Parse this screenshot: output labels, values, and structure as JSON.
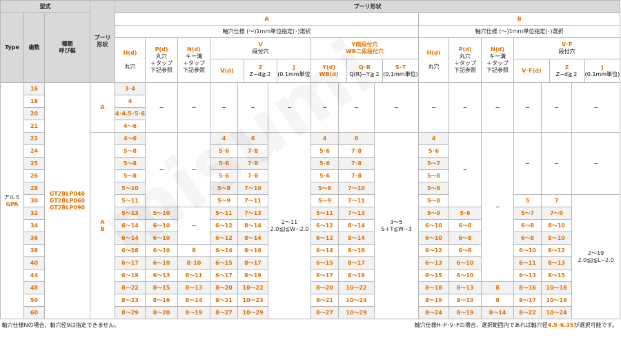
{
  "headers": {
    "katashiki": "型式",
    "type": "Type",
    "hasu": "歯数",
    "shurui_1": "種類",
    "shurui_2": "呼び幅",
    "pulley_shape_1": "プーリ",
    "pulley_shape_2": "形状",
    "pulley_shape_title": "プーリ形状",
    "group_a": "A",
    "group_b": "B",
    "spec_text": "軸穴仕様 (～)1mm単位指定(･)選択"
  },
  "subheaders": {
    "h_label": "H(d)",
    "h_sub": "丸穴",
    "p_label": "P(d)",
    "p_sub1": "丸穴",
    "p_sub2": "＋タップ",
    "p_sub3": "下記参照",
    "n_label": "N(d)",
    "n_sub1": "キー溝",
    "n_sub2": "＋タップ",
    "n_sub3": "下記参照",
    "v_top": "V",
    "v_sub": "段付穴",
    "y_top": "Y両段付穴",
    "wb_top": "WB二段段付穴",
    "v_label": "V(d)",
    "z_label": "Z",
    "z_sub": "Z−d≧２",
    "j_label": "J",
    "j_sub": "(0.1mm単位)",
    "y_label": "Y(d)",
    "wb_label": "WB(d)",
    "qr_label": "Q･R",
    "qr_sub": "Q(R)−Y≧２",
    "st_label": "S･T",
    "st_sub": "(0.1mm単位)",
    "vf_top": "V･F",
    "vf_sub": "段付穴",
    "vf_label": "V･F(d)",
    "z2_sub": "Z−d≧２",
    "j2_sub": "(0.1mm単位)"
  },
  "body": {
    "type_name": "アルミ",
    "type_code": "GPA",
    "models": [
      "GT2BLP040",
      "GT2BLP060",
      "GT2BLP090"
    ],
    "shape_a": "A",
    "shape_ab": "A",
    "shape_ab2": "B",
    "dash": "−",
    "j_a_range": "2～11",
    "j_a_cond": "2.0≦J≦W−2.0",
    "st_range": "3～5",
    "st_cond": "S＋T≦W−3",
    "j_b_range": "2～19",
    "j_b_cond": "2.0≦J≦L−2.0"
  },
  "rows": [
    {
      "teeth": "16",
      "h": "3･4",
      "v": "−",
      "z": "−",
      "y": "−",
      "qr": "−",
      "hb": "−",
      "vf": "−",
      "z2": "−"
    },
    {
      "teeth": "18",
      "h": "4",
      "v": "",
      "z": "",
      "y": "",
      "qr": "",
      "hb": "",
      "vf": "",
      "z2": ""
    },
    {
      "teeth": "20",
      "h": "4･4.5･5･6",
      "v": "",
      "z": "",
      "y": "",
      "qr": "",
      "hb": "",
      "vf": "",
      "z2": ""
    },
    {
      "teeth": "21",
      "h": "4～6",
      "v": "",
      "z": "",
      "y": "",
      "qr": "",
      "hb": "",
      "vf": "",
      "z2": ""
    },
    {
      "teeth": "22",
      "h": "4～6",
      "v": "4",
      "z": "6",
      "y": "4",
      "qr": "6",
      "hb": "4",
      "vf": "",
      "z2": ""
    },
    {
      "teeth": "24",
      "h": "5～8",
      "v": "5･6",
      "z": "7･8",
      "y": "5･6",
      "qr": "7･8",
      "hb": "5･6",
      "vf": "",
      "z2": ""
    },
    {
      "teeth": "25",
      "h": "5～8",
      "v": "5･6",
      "z": "7･8",
      "y": "5･6",
      "qr": "7･8",
      "hb": "5～7",
      "vf": "",
      "z2": ""
    },
    {
      "teeth": "26",
      "h": "5～8",
      "v": "5･6",
      "z": "7･8",
      "y": "5･6",
      "qr": "7･8",
      "hb": "5～8",
      "vf": "",
      "z2": ""
    },
    {
      "teeth": "28",
      "h": "5～10",
      "v": "5～8",
      "z": "7～10",
      "y": "5～8",
      "qr": "7～10",
      "hb": "5～8",
      "vf": "",
      "z2": ""
    },
    {
      "teeth": "30",
      "h": "5～11",
      "v": "5～9",
      "z": "7～11",
      "y": "5～9",
      "qr": "7～11",
      "hb": "5～8",
      "vf": "5",
      "z2": "7"
    },
    {
      "teeth": "32",
      "h": "5～13",
      "p": "5～10",
      "v": "5～11",
      "z": "7～13",
      "y": "5～11",
      "qr": "7～13",
      "hb": "5～9",
      "pb": "5･6",
      "vf": "5～7",
      "z2": "7～9"
    },
    {
      "teeth": "34",
      "h": "6～14",
      "p": "6～10",
      "v": "6～12",
      "z": "8～14",
      "y": "6～12",
      "qr": "8～14",
      "hb": "6～10",
      "pb": "6～8",
      "vf": "6～8",
      "z2": "8～10"
    },
    {
      "teeth": "36",
      "h": "6～14",
      "p": "6～10",
      "v": "6～12",
      "z": "8～14",
      "y": "6～12",
      "qr": "8～14",
      "hb": "6～10",
      "pb": "6～8",
      "vf": "6～8",
      "z2": "8～10"
    },
    {
      "teeth": "38",
      "h": "6～16",
      "p": "6～10",
      "n": "8",
      "v": "6～14",
      "z": "8～16",
      "y": "6～14",
      "qr": "8～16",
      "hb": "6～12",
      "pb": "6～8",
      "vf": "6～10",
      "z2": "8～12"
    },
    {
      "teeth": "40",
      "h": "6～17",
      "p": "6～10",
      "n": "8･10",
      "v": "6～15",
      "z": "8～17",
      "y": "6～15",
      "qr": "8～17",
      "hb": "6～13",
      "pb": "6～10",
      "vf": "6～11",
      "z2": "8～13"
    },
    {
      "teeth": "44",
      "h": "6～19",
      "p": "6～13",
      "n": "8～11",
      "v": "6～17",
      "z": "8～19",
      "y": "6～17",
      "qr": "8～19",
      "hb": "6～15",
      "pb": "6～10",
      "vf": "6～13",
      "z2": "8～15"
    },
    {
      "teeth": "48",
      "h": "8～22",
      "p": "8～15",
      "n": "8～13",
      "v": "8～20",
      "z": "10～22",
      "y": "8～20",
      "qr": "10～22",
      "hb": "8～18",
      "pb": "8～13",
      "nb": "8",
      "vf": "8～16",
      "z2": "10～18"
    },
    {
      "teeth": "50",
      "h": "8～23",
      "p": "8～16",
      "n": "8～14",
      "v": "8～21",
      "z": "10～23",
      "y": "8～21",
      "qr": "10～23",
      "hb": "8～19",
      "pb": "8～13",
      "nb": "8",
      "vf": "8～17",
      "z2": "10～19"
    },
    {
      "teeth": "60",
      "h": "8～29",
      "p": "8～20",
      "n": "8～19",
      "v": "8～27",
      "z": "10～29",
      "y": "8～27",
      "qr": "10～29",
      "hb": "8～24",
      "pb": "8～19",
      "nb": "8～14",
      "vf": "8～22",
      "z2": "10～24"
    }
  ],
  "footer": {
    "note_left": "軸穴仕様Nの場合、軸穴径9は指定できません。",
    "note_right_1": "軸穴仕様H･P･V･Fの場合、選択範囲内であれば軸穴径",
    "note_right_2": "4.5･6.35",
    "note_right_3": "が選択可能です。"
  },
  "watermark": "misumi"
}
